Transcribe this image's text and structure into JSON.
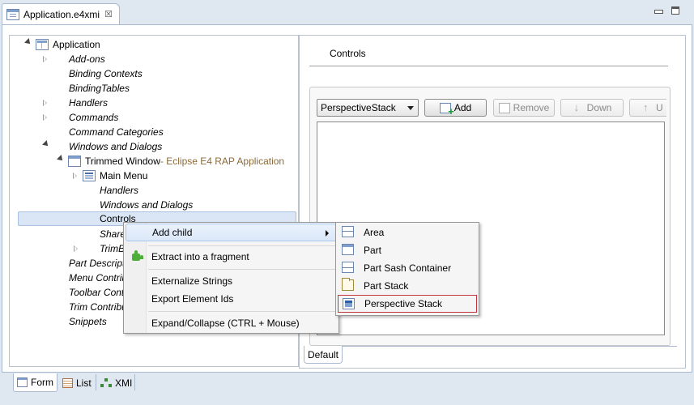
{
  "editor": {
    "tab_title": "Application.e4xmi",
    "close_glyph": "☒"
  },
  "tree": {
    "items": [
      {
        "label": "Application",
        "icon": "application-icon",
        "state": "expanded"
      },
      {
        "label": "Add-ons",
        "state": "collapsed"
      },
      {
        "label": "Binding Contexts"
      },
      {
        "label": "BindingTables"
      },
      {
        "label": "Handlers",
        "state": "collapsed"
      },
      {
        "label": "Commands",
        "state": "collapsed"
      },
      {
        "label": "Command Categories"
      },
      {
        "label": "Windows and Dialogs",
        "state": "expanded"
      },
      {
        "label": "Trimmed Window",
        "suffix": " - Eclipse E4 RAP Application",
        "icon": "window-icon",
        "state": "expanded"
      },
      {
        "label": "Main Menu",
        "icon": "menu-icon",
        "state": "collapsed"
      },
      {
        "label": "Handlers"
      },
      {
        "label": "Windows and Dialogs"
      },
      {
        "label": "Controls",
        "selected": true
      },
      {
        "label": "Shared"
      },
      {
        "label": "TrimBa",
        "state": "collapsed"
      },
      {
        "label": "Part Descripto"
      },
      {
        "label": "Menu Contribu"
      },
      {
        "label": "Toolbar Contri"
      },
      {
        "label": "Trim Contribu"
      },
      {
        "label": "Snippets"
      }
    ]
  },
  "details": {
    "title": "Controls",
    "combo_value": "PerspectiveStack",
    "add_label": "Add",
    "remove_label": "Remove",
    "down_label": "Down",
    "up_label": "U",
    "default_tab": "Default"
  },
  "context_menu": {
    "add_child": "Add child",
    "extract": "Extract into a fragment",
    "externalize": "Externalize Strings",
    "export_ids": "Export Element Ids",
    "expand_collapse": "Expand/Collapse (CTRL + Mouse)"
  },
  "submenu": {
    "items": [
      "Area",
      "Part",
      "Part Sash Container",
      "Part Stack",
      "Perspective Stack"
    ]
  },
  "bottom_tabs": {
    "form": "Form",
    "list": "List",
    "xmi": "XMI"
  }
}
